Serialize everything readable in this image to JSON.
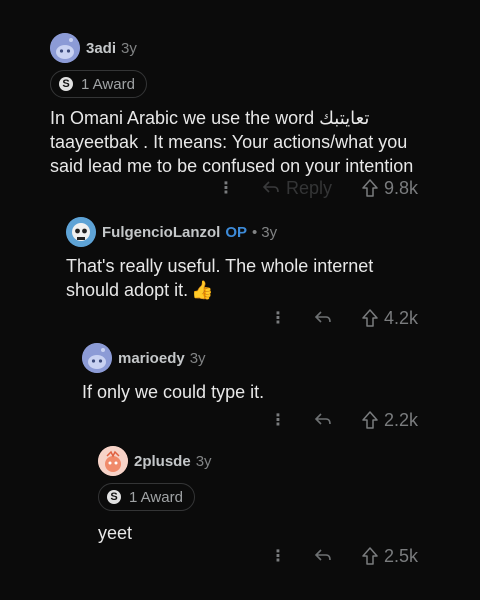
{
  "comments": [
    {
      "username": "3adi",
      "age": "3y",
      "award": "1 Award",
      "award_icon": "S",
      "text_lines": [
        "In Omani Arabic we use the word تعايتبك",
        "taayeetbak . It means: Your actions/what you",
        "said lead me to be confused on your intention"
      ],
      "reply": "Reply",
      "votes": "9.8k"
    },
    {
      "username": "FulgencioLanzol",
      "op": "OP",
      "dot": "•",
      "age": "3y",
      "text_lines": [
        "That's really useful. The whole internet",
        "should adopt it."
      ],
      "emoji": "👍",
      "votes": "4.2k"
    },
    {
      "username": "marioedy",
      "age": "3y",
      "text_lines": [
        "If only we could type it."
      ],
      "votes": "2.2k"
    },
    {
      "username": "2plusde",
      "age": "3y",
      "award": "1 Award",
      "award_icon": "S",
      "text_lines": [
        "yeet"
      ],
      "votes": "2.5k"
    }
  ],
  "icons": {
    "more": "more-options-icon",
    "reply": "reply-arrow-icon",
    "upvote": "upvote-arrow-icon"
  },
  "colors": {
    "background": "#0b0b0b",
    "op_blue": "#3d8bd9",
    "snoo_blue": "#8c9bd6",
    "snoo_orange": "#f08a6a"
  }
}
